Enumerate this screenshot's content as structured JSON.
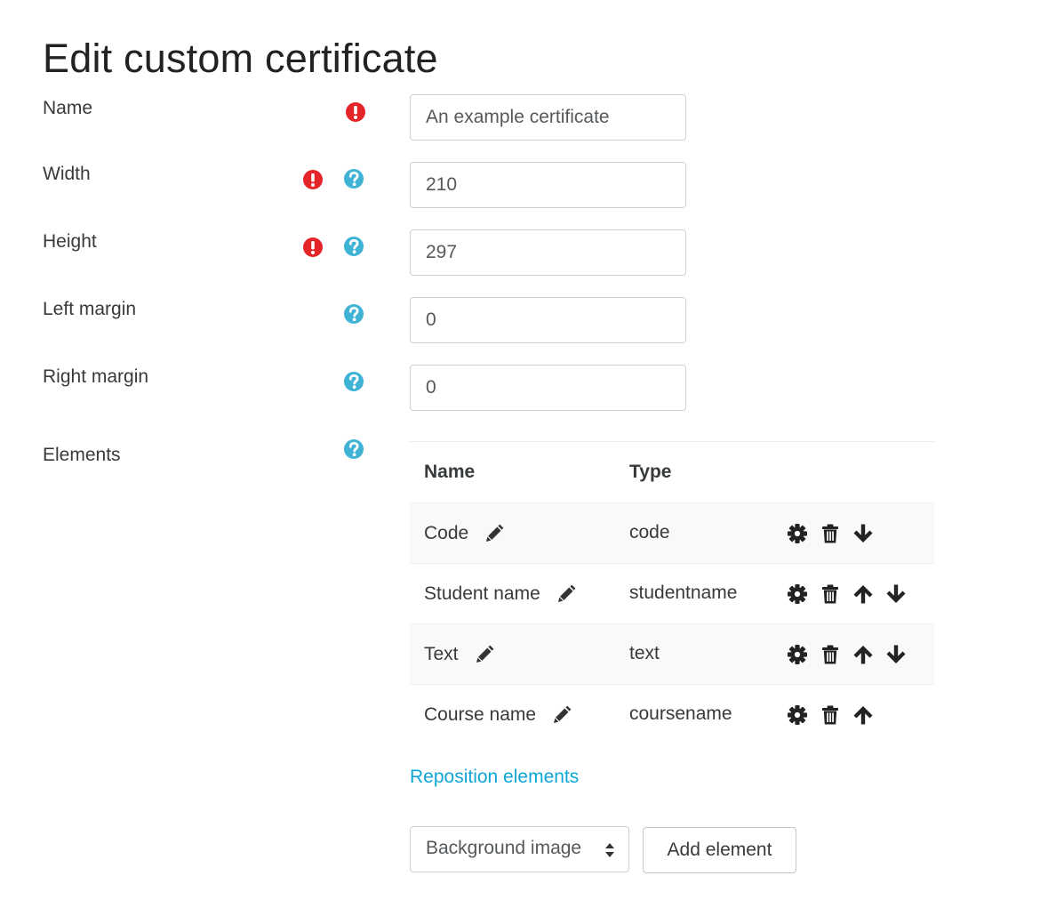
{
  "page": {
    "title": "Edit custom certificate"
  },
  "form": {
    "name": {
      "label": "Name",
      "value": "An example certificate",
      "required": true
    },
    "width": {
      "label": "Width",
      "value": "210",
      "required": true,
      "help": true
    },
    "height": {
      "label": "Height",
      "value": "297",
      "required": true,
      "help": true
    },
    "left_margin": {
      "label": "Left margin",
      "value": "0",
      "help": true
    },
    "right_margin": {
      "label": "Right margin",
      "value": "0",
      "help": true
    },
    "elements_label": "Elements"
  },
  "elements_table": {
    "headers": {
      "name": "Name",
      "type": "Type"
    },
    "rows": [
      {
        "name": "Code",
        "type": "code",
        "actions": [
          "settings-icon",
          "delete-icon",
          "move-down-icon"
        ]
      },
      {
        "name": "Student name",
        "type": "studentname",
        "actions": [
          "settings-icon",
          "delete-icon",
          "move-up-icon",
          "move-down-icon"
        ]
      },
      {
        "name": "Text",
        "type": "text",
        "actions": [
          "settings-icon",
          "delete-icon",
          "move-up-icon",
          "move-down-icon"
        ]
      },
      {
        "name": "Course name",
        "type": "coursename",
        "actions": [
          "settings-icon",
          "delete-icon",
          "move-up-icon"
        ]
      }
    ]
  },
  "reposition_link": "Reposition elements",
  "element_select": {
    "selected": "Background image"
  },
  "add_element_button": "Add element",
  "colors": {
    "link": "#0ea6d6",
    "required": "#e5252a",
    "help": "#3fb3d6",
    "text": "#373a3c"
  }
}
